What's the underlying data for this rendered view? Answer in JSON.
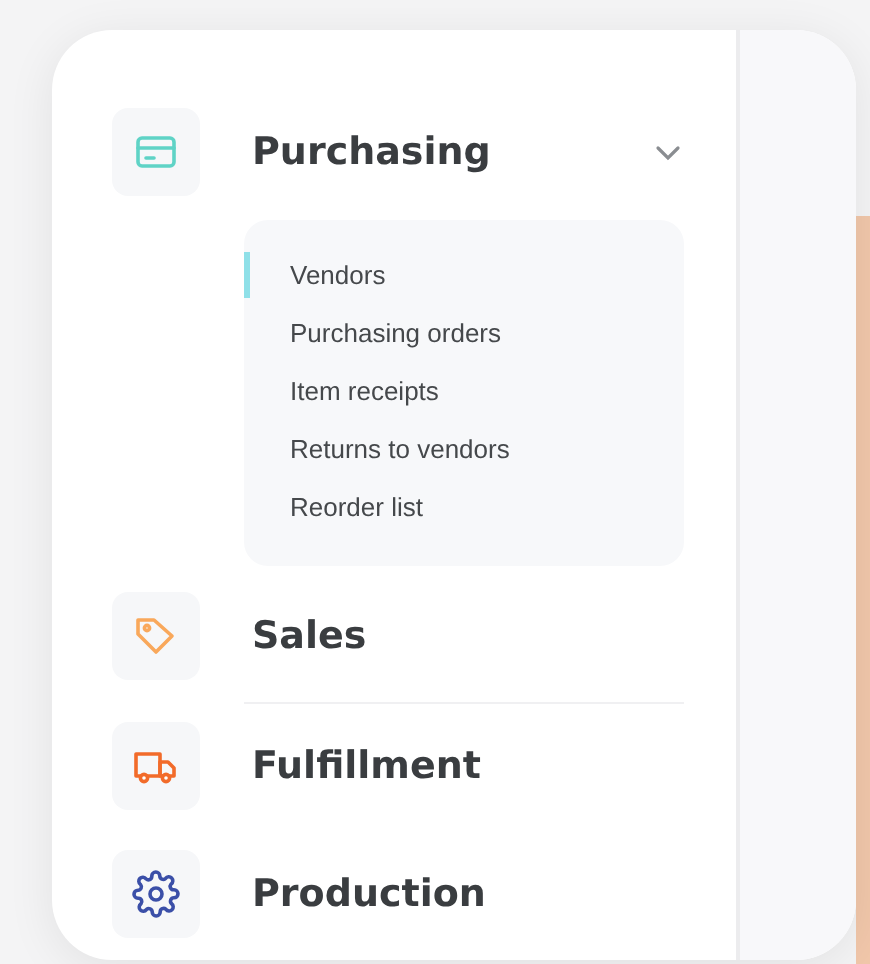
{
  "sections": [
    {
      "label": "Purchasing",
      "color": "#5fd3c6",
      "expanded": true,
      "items": [
        {
          "label": "Vendors",
          "selected": true
        },
        {
          "label": "Purchasing orders",
          "selected": false
        },
        {
          "label": "Item receipts",
          "selected": false
        },
        {
          "label": "Returns to vendors",
          "selected": false
        },
        {
          "label": "Reorder list",
          "selected": false
        }
      ]
    },
    {
      "label": "Sales",
      "color": "#f9a85b",
      "expanded": false
    },
    {
      "label": "Fulfillment",
      "color": "#f26b2a",
      "expanded": false
    },
    {
      "label": "Production",
      "color": "#3b4fa8",
      "expanded": false
    }
  ]
}
